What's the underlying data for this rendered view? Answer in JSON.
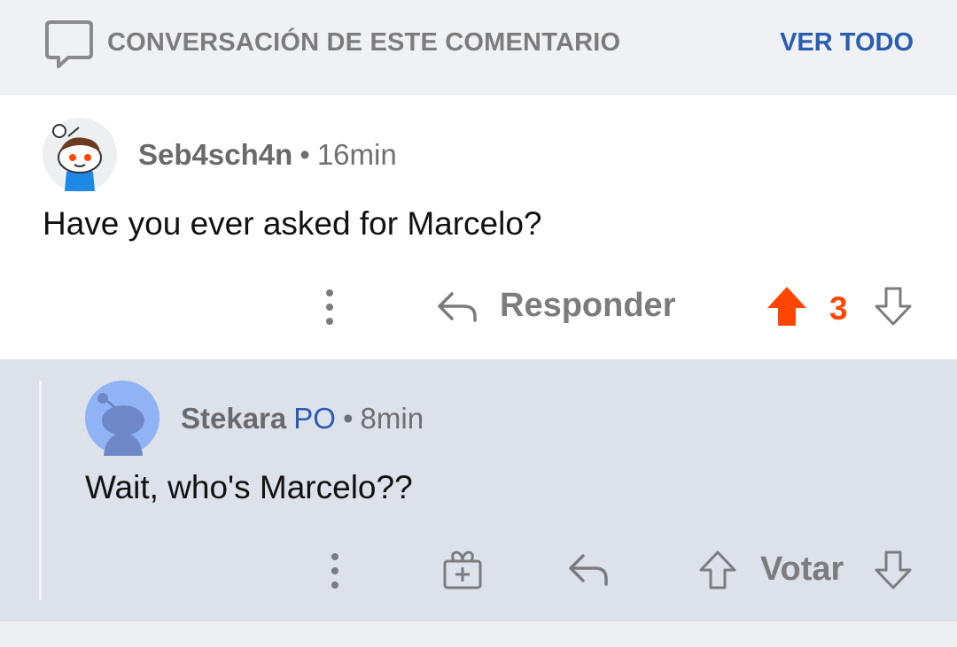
{
  "header": {
    "title": "CONVERSACIÓN DE ESTE COMENTARIO",
    "view_all": "VER TODO"
  },
  "parent_comment": {
    "username": "Seb4sch4n",
    "separator": "•",
    "time": "16min",
    "body": "Have you ever asked for Marcelo?",
    "reply_label": "Responder",
    "score": "3",
    "upvoted": true
  },
  "reply_comment": {
    "username": "Stekara",
    "op_badge": "PO",
    "separator": "•",
    "time": "8min",
    "body": "Wait, who's Marcelo??",
    "vote_label": "Votar"
  },
  "colors": {
    "accent_blue": "#2a5db0",
    "upvote_orange": "#ff4500",
    "muted_gray": "#7c7c7e"
  }
}
